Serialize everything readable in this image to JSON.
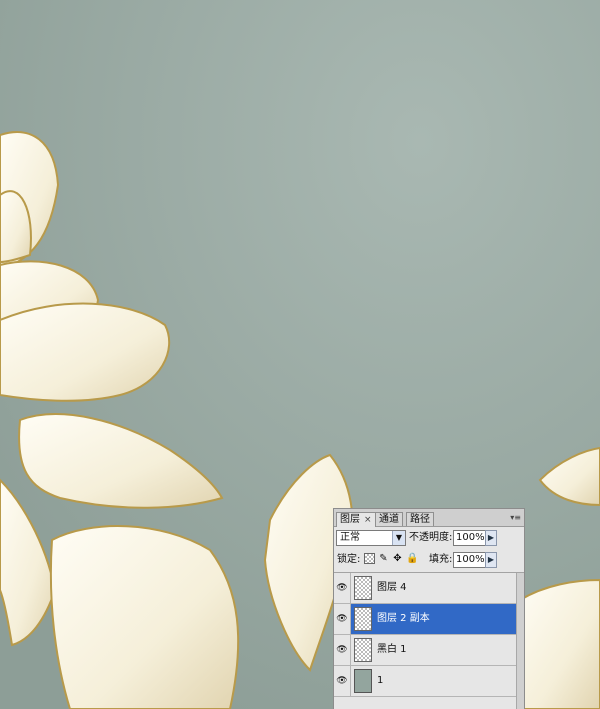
{
  "layers_panel": {
    "tabs": [
      {
        "label": "图层",
        "active": true,
        "close": "×"
      },
      {
        "label": "通道",
        "active": false
      },
      {
        "label": "路径",
        "active": false
      }
    ],
    "blend_mode": "正常",
    "opacity_label": "不透明度:",
    "opacity_value": "100%",
    "lock_label": "锁定:",
    "fill_label": "填充:",
    "fill_value": "100%",
    "layers": [
      {
        "name": "图层 4",
        "visible": true,
        "selected": false,
        "thumb": "transparent"
      },
      {
        "name": "图层 2 副本",
        "visible": true,
        "selected": true,
        "thumb": "transparent"
      },
      {
        "name": "黑白 1",
        "visible": true,
        "selected": false,
        "thumb": "transparent"
      },
      {
        "name": "1",
        "visible": true,
        "selected": false,
        "thumb": "solid"
      }
    ]
  },
  "colors": {
    "canvas_bg": "#96a69f",
    "petal": "#f7f3e3",
    "petal_outline": "#b89a4a",
    "selection": "#3169c6"
  },
  "icons": {
    "eye": "eye-icon",
    "lock_transparent": "lock-transparent-icon",
    "lock_paint": "brush-icon",
    "lock_move": "move-icon",
    "lock_all": "padlock-icon",
    "dropdown": "chevron-down-icon",
    "spin": "triangle-right-icon"
  }
}
